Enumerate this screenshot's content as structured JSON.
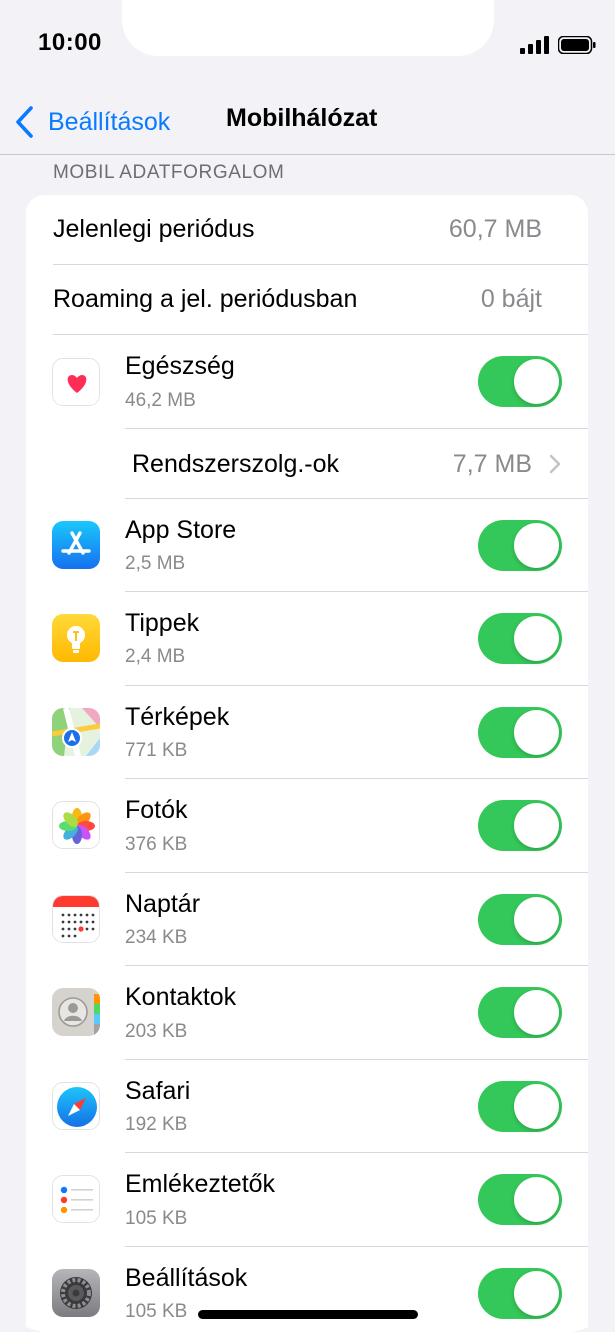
{
  "status": {
    "time": "10:00"
  },
  "nav": {
    "back_label": "Beállítások",
    "title": "Mobilhálózat"
  },
  "section": {
    "header": "MOBIL ADATFORGALOM"
  },
  "summary": [
    {
      "label": "Jelenlegi periódus",
      "value": "60,7 MB"
    },
    {
      "label": "Roaming a jel. periódusban",
      "value": "0 bájt"
    }
  ],
  "system_services": {
    "label": "Rendszerszolg.-ok",
    "value": "7,7 MB"
  },
  "apps": [
    {
      "name": "Egészség",
      "size": "46,2 MB",
      "icon": "health-icon",
      "enabled": true
    },
    {
      "name": "App Store",
      "size": "2,5 MB",
      "icon": "app-store-icon",
      "enabled": true
    },
    {
      "name": "Tippek",
      "size": "2,4 MB",
      "icon": "tips-icon",
      "enabled": true
    },
    {
      "name": "Térképek",
      "size": "771 KB",
      "icon": "maps-icon",
      "enabled": true
    },
    {
      "name": "Fotók",
      "size": "376 KB",
      "icon": "photos-icon",
      "enabled": true
    },
    {
      "name": "Naptár",
      "size": "234 KB",
      "icon": "calendar-icon",
      "enabled": true
    },
    {
      "name": "Kontaktok",
      "size": "203 KB",
      "icon": "contacts-icon",
      "enabled": true
    },
    {
      "name": "Safari",
      "size": "192 KB",
      "icon": "safari-icon",
      "enabled": true
    },
    {
      "name": "Emlékeztetők",
      "size": "105 KB",
      "icon": "reminders-icon",
      "enabled": true
    },
    {
      "name": "Beállítások",
      "size": "105 KB",
      "icon": "settings-icon",
      "enabled": true
    }
  ],
  "colors": {
    "accent": "#0a7aff",
    "toggle_on": "#34c759",
    "background": "#f2f2f7"
  }
}
